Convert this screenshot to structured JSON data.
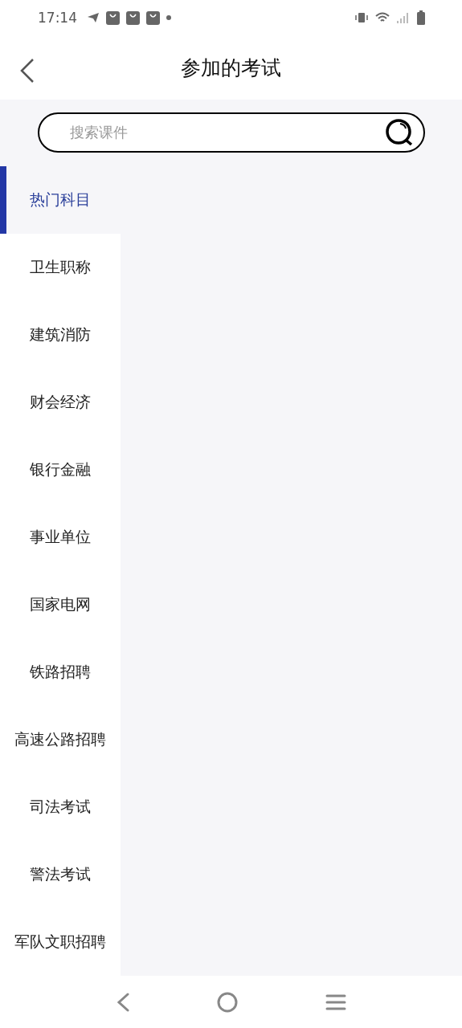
{
  "status_bar": {
    "time": "17:14"
  },
  "header": {
    "title": "参加的考试"
  },
  "search": {
    "placeholder": "搜索课件"
  },
  "categories": [
    {
      "label": "热门科目",
      "selected": true
    },
    {
      "label": "卫生职称",
      "selected": false
    },
    {
      "label": "建筑消防",
      "selected": false
    },
    {
      "label": "财会经济",
      "selected": false
    },
    {
      "label": "银行金融",
      "selected": false
    },
    {
      "label": "事业单位",
      "selected": false
    },
    {
      "label": "国家电网",
      "selected": false
    },
    {
      "label": "铁路招聘",
      "selected": false
    },
    {
      "label": "高速公路招聘",
      "selected": false
    },
    {
      "label": "司法考试",
      "selected": false
    },
    {
      "label": "警法考试",
      "selected": false
    },
    {
      "label": "军队文职招聘",
      "selected": false
    }
  ]
}
